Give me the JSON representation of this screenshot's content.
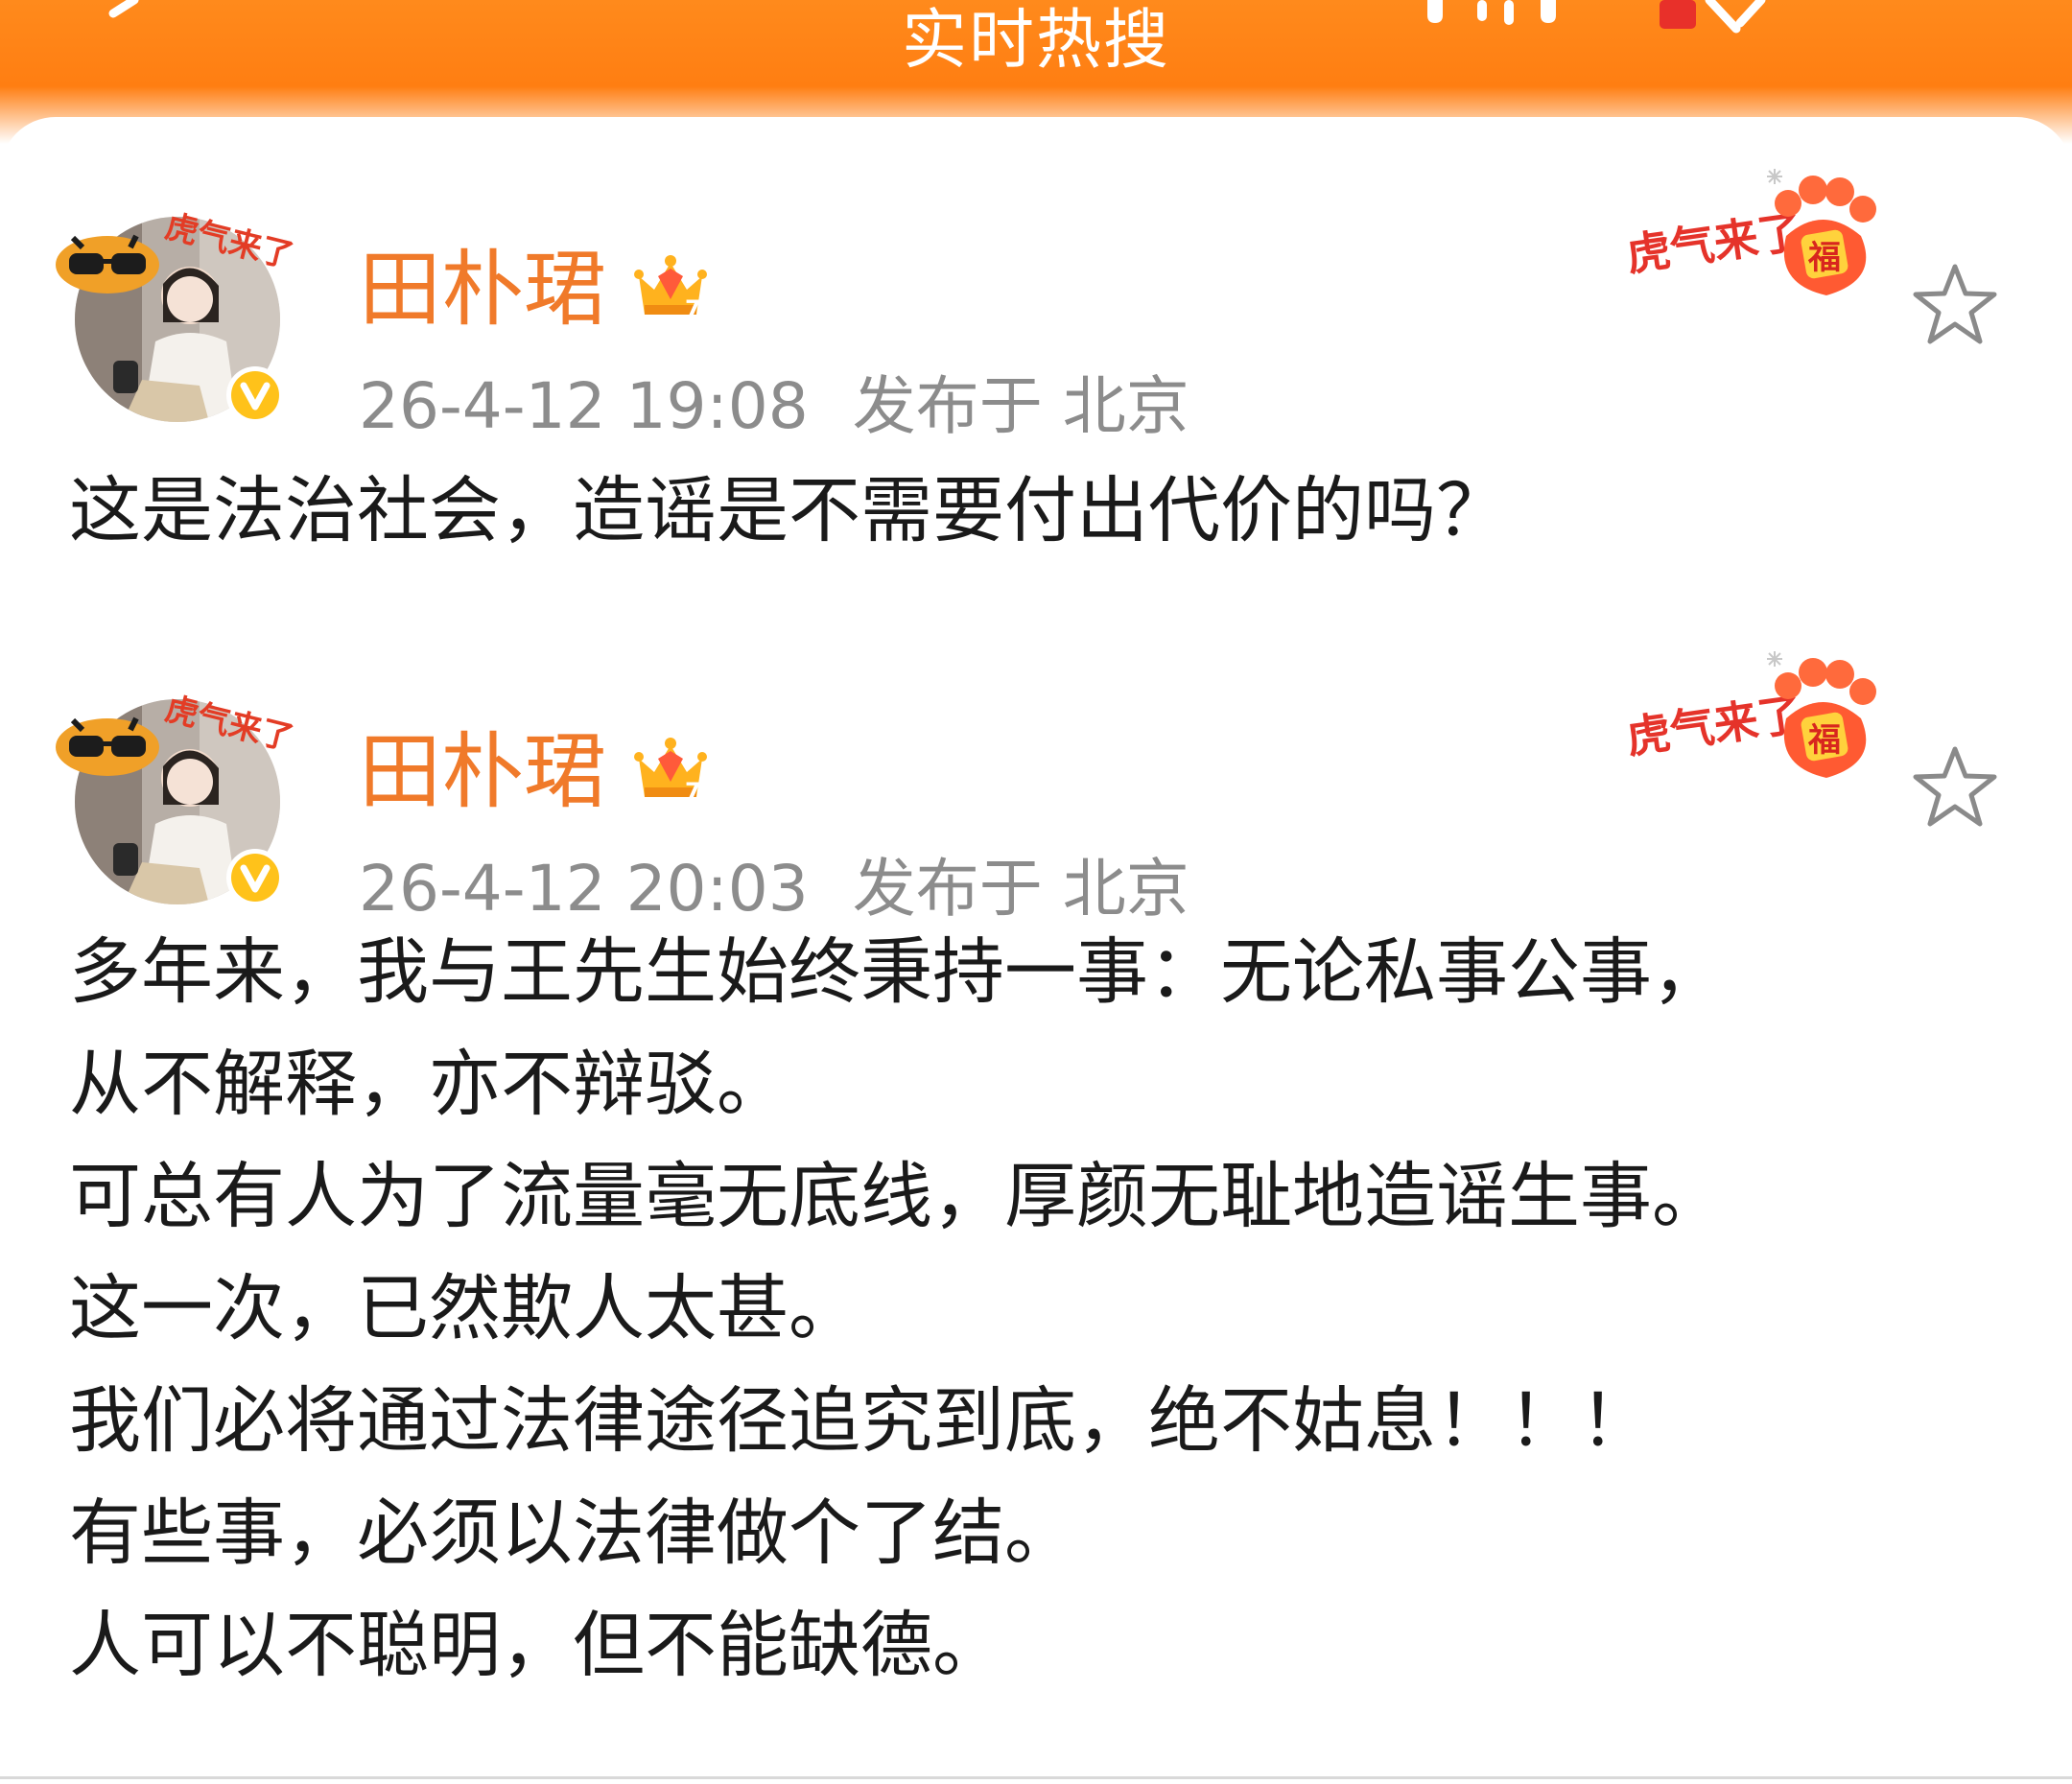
{
  "nav": {
    "title": "实时热搜"
  },
  "sticker_text": "虎气来了",
  "sticker_badge": "福",
  "colors": {
    "header": "#ff7e12",
    "username": "#f07a2a",
    "meta": "#8c8c8c",
    "verified": "#ffc21a"
  },
  "icons": {
    "back": "chevron-left-icon",
    "more": "more-icon",
    "close": "close-icon",
    "verified": "verified-v-icon",
    "member": "crown-icon",
    "favorite": "star-icon"
  },
  "posts": [
    {
      "username": "田朴珺",
      "member_level": "7",
      "date": "26-4-12 19:08",
      "location": "发布于 北京",
      "text": "这是法治社会，造谣是不需要付出代价的吗？"
    },
    {
      "username": "田朴珺",
      "member_level": "7",
      "date": "26-4-12 20:03",
      "location": "发布于 北京",
      "text": "多年来，我与王先生始终秉持一事：无论私事公事，\n从不解释，亦不辩驳。\n可总有人为了流量毫无底线，厚颜无耻地造谣生事。\n这一次，已然欺人太甚。\n我们必将通过法律途径追究到底，绝不姑息！！！\n有些事，必须以法律做个了结。\n人可以不聪明，但不能缺德。"
    }
  ]
}
